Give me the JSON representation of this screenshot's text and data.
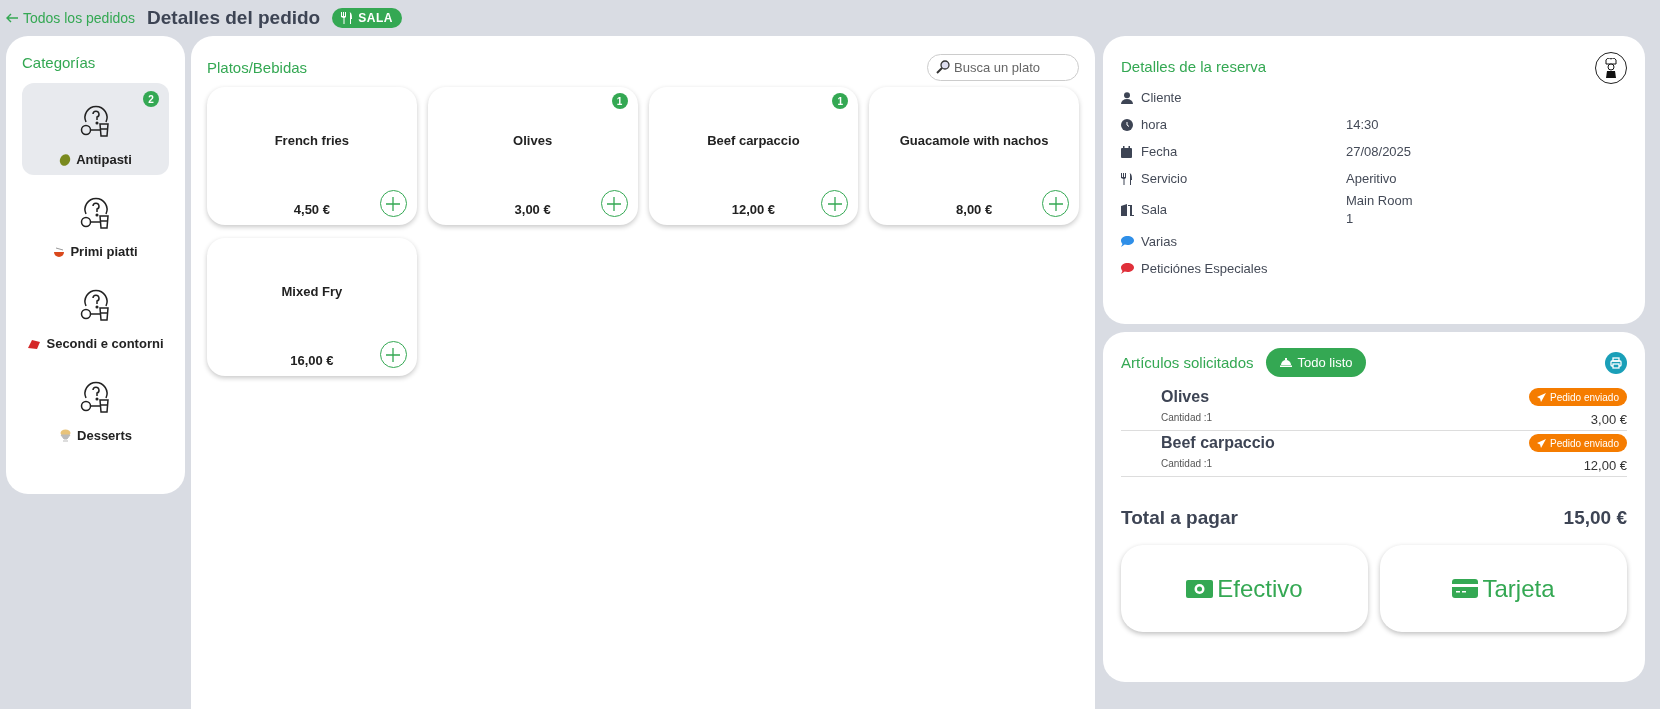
{
  "header": {
    "back_link": "Todos los pedidos",
    "title": "Detalles del pedido",
    "badge": "SALA"
  },
  "categories": {
    "title": "Categorías",
    "items": [
      {
        "label": "Antipasti",
        "selected": true,
        "count": "2"
      },
      {
        "label": "Primi piatti",
        "selected": false
      },
      {
        "label": "Secondi e contorni",
        "selected": false
      },
      {
        "label": "Desserts",
        "selected": false
      }
    ]
  },
  "dishes": {
    "title": "Platos/Bebidas",
    "search": {
      "placeholder": "Busca un plato"
    },
    "items": [
      {
        "name": "French fries",
        "price": "4,50 €"
      },
      {
        "name": "Olives",
        "price": "3,00 €",
        "count": "1"
      },
      {
        "name": "Beef carpaccio",
        "price": "12,00 €",
        "count": "1"
      },
      {
        "name": "Guacamole with nachos",
        "price": "8,00 €"
      },
      {
        "name": "Mixed Fry",
        "price": "16,00 €"
      }
    ]
  },
  "reservation": {
    "title": "Detalles de la reserva",
    "rows": [
      {
        "kind": "person",
        "label": "Cliente"
      },
      {
        "kind": "clock",
        "label": "hora",
        "value": "14:30"
      },
      {
        "kind": "calendar",
        "label": "Fecha",
        "value": "27/08/2025"
      },
      {
        "kind": "cutlery",
        "label": "Servicio",
        "value": "Aperitivo"
      },
      {
        "kind": "door",
        "label": "Sala",
        "value": "Main Room",
        "value_2": "1"
      },
      {
        "kind": "chat",
        "label": "Varias",
        "color": "#2f8fe8"
      },
      {
        "kind": "chat",
        "label": "Peticiónes Especiales",
        "color": "#e0303a"
      }
    ]
  },
  "ordered": {
    "title": "Artículos solicitados",
    "ready_button": "Todo listo",
    "items": [
      {
        "name": "Olives",
        "quantity": "Cantidad :1",
        "status": "Pedido enviado",
        "price": "3,00 €"
      },
      {
        "name": "Beef carpaccio",
        "quantity": "Cantidad :1",
        "status": "Pedido enviado",
        "price": "12,00 €"
      }
    ],
    "total_label": "Total a pagar",
    "total": "15,00 €",
    "payments": [
      {
        "kind": "cash",
        "label": "Efectivo"
      },
      {
        "kind": "card",
        "label": "Tarjeta"
      }
    ]
  }
}
